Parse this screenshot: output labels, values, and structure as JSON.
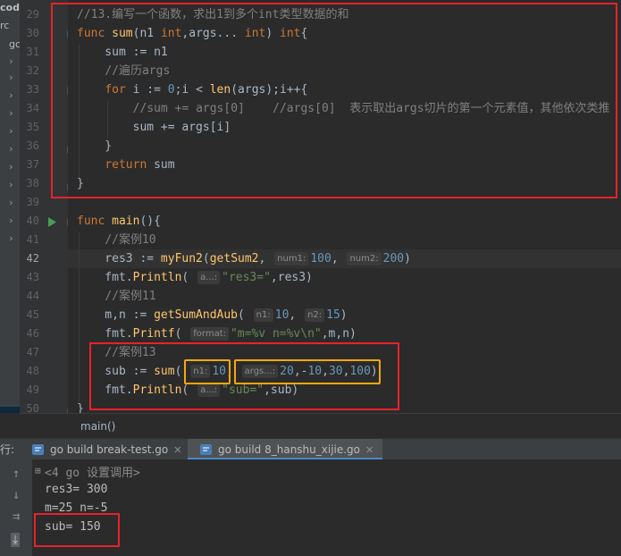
{
  "project_panel": {
    "fragments": [
      "code",
      "rc",
      "gc"
    ]
  },
  "editor": {
    "line_numbers": [
      "29",
      "30",
      "31",
      "32",
      "33",
      "34",
      "35",
      "36",
      "37",
      "38",
      "39",
      "40",
      "41",
      "42",
      "43",
      "44",
      "45",
      "46",
      "47",
      "48",
      "49",
      "50"
    ],
    "current_line": "42",
    "comment_29": "//13.编写一个函数，求出1到多个int类型数据的和",
    "comment_32": "//遍历args",
    "comment_34": "//sum += args[0]    //args[0]  表示取出args切片的第一个元素值，其他依次类推",
    "comment_41": "//案例10",
    "comment_44": "//案例11",
    "comment_47": "//案例13",
    "hints": {
      "num1": "num1:",
      "num2": "num2:",
      "a1": "a...:",
      "format": "format:",
      "n1": "n1:",
      "n2": "n2:",
      "n1b": "n1:",
      "args": "args...:",
      "a2": "a...:"
    },
    "breadcrumb": "main()"
  },
  "run_panel": {
    "label": "行:",
    "tabs": [
      {
        "label": "go build break-test.go",
        "active": false
      },
      {
        "label": "go build 8_hanshu_xijie.go",
        "active": true
      }
    ],
    "output": [
      "<4 go 设置调用>",
      "res3= 300",
      "m=25 n=-5",
      "sub= 150"
    ]
  },
  "colors": {
    "annotation_red": "#e8222c",
    "annotation_yellow": "#f5a80c",
    "keyword": "#cc7832",
    "function": "#ffc66d",
    "number": "#6897bb",
    "string": "#6a8759"
  }
}
